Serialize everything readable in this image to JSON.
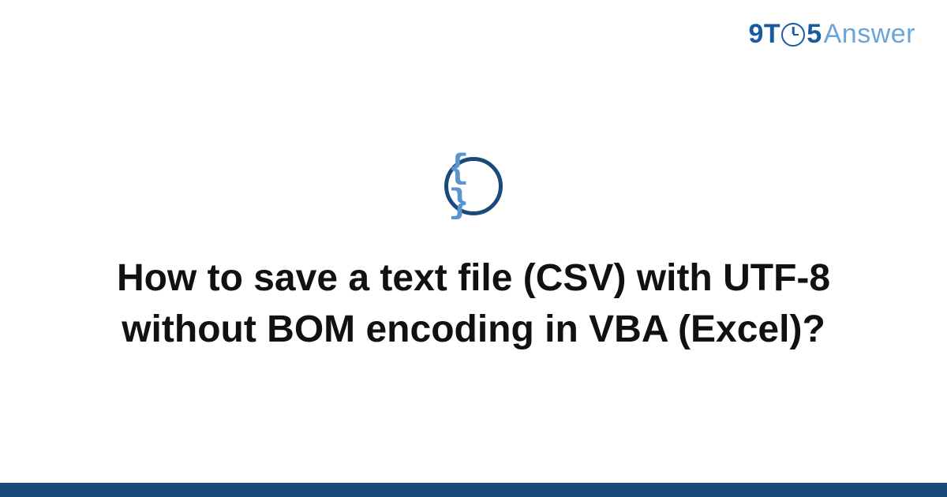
{
  "logo": {
    "part1": "9T",
    "part2": "5",
    "part3": "Answer"
  },
  "icon": {
    "brace": "{ }"
  },
  "title": "How to save a text file (CSV) with UTF-8 without BOM encoding in VBA (Excel)?"
}
